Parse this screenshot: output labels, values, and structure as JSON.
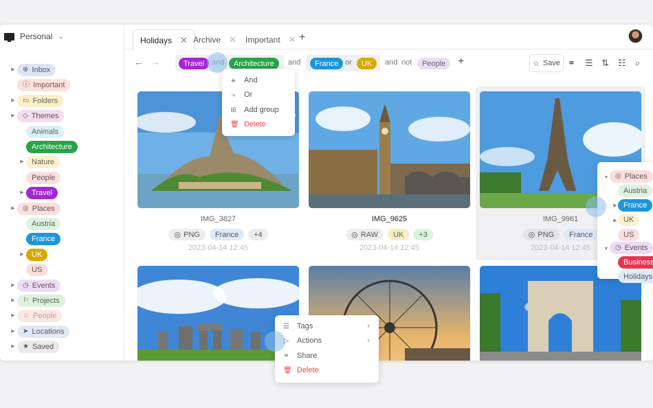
{
  "workspace": {
    "name": "Personal"
  },
  "tabs": [
    {
      "label": "Holidays",
      "active": true
    },
    {
      "label": "Archive",
      "active": false
    },
    {
      "label": "Important",
      "active": false
    }
  ],
  "sidebar": {
    "items": [
      {
        "label": "Inbox",
        "icon": "inbox-icon",
        "glyph": "⊕",
        "bg": "#dde5f3",
        "fg": "#556",
        "indent": 0,
        "arrow": true
      },
      {
        "label": "Important",
        "icon": "alert-icon",
        "glyph": "ⓘ",
        "bg": "#fbe0dd",
        "fg": "#755",
        "indent": 0,
        "arrow": false
      },
      {
        "label": "Folders",
        "icon": "folder-icon",
        "glyph": "▭",
        "bg": "#fbefc8",
        "fg": "#665",
        "indent": 0,
        "arrow": true
      },
      {
        "label": "Themes",
        "icon": "tag-icon",
        "glyph": "◇",
        "bg": "#f2dcef",
        "fg": "#655",
        "indent": 0,
        "arrow": true
      },
      {
        "label": "Animals",
        "bg": "#ddeff5",
        "fg": "#566",
        "indent": 1,
        "arrow": false
      },
      {
        "label": "Architecture",
        "bg": "#27a349",
        "fg": "#fff",
        "indent": 1,
        "arrow": false
      },
      {
        "label": "Nature",
        "bg": "#fbf0cf",
        "fg": "#665",
        "indent": 1,
        "arrow": true
      },
      {
        "label": "People",
        "bg": "#f9dede",
        "fg": "#655",
        "indent": 1,
        "arrow": false
      },
      {
        "label": "Travel",
        "bg": "#a526d6",
        "fg": "#fff",
        "indent": 1,
        "arrow": true
      },
      {
        "label": "Places",
        "icon": "pin-icon",
        "glyph": "◎",
        "bg": "#f9dede",
        "fg": "#655",
        "indent": 0,
        "arrow": true
      },
      {
        "label": "Austria",
        "bg": "#def2df",
        "fg": "#565",
        "indent": 1,
        "arrow": false
      },
      {
        "label": "France",
        "bg": "#1e95d8",
        "fg": "#fff",
        "indent": 1,
        "arrow": false
      },
      {
        "label": "UK",
        "bg": "#d9a800",
        "fg": "#fff",
        "indent": 1,
        "arrow": true
      },
      {
        "label": "US",
        "bg": "#f9dede",
        "fg": "#655",
        "indent": 1,
        "arrow": false
      },
      {
        "label": "Events",
        "icon": "clock-icon",
        "glyph": "◷",
        "bg": "#ecdcf4",
        "fg": "#655",
        "indent": 0,
        "arrow": true
      },
      {
        "label": "Projects",
        "icon": "flag-icon",
        "glyph": "⚐",
        "bg": "#ddf1dc",
        "fg": "#565",
        "indent": 0,
        "arrow": true
      },
      {
        "label": "People",
        "icon": "people-icon",
        "glyph": "☺",
        "bg": "#fbe7e4",
        "fg": "#b9a0a0",
        "indent": 0,
        "arrow": true
      },
      {
        "label": "Locations",
        "icon": "location-icon",
        "glyph": "➤",
        "bg": "#e2e8f5",
        "fg": "#556",
        "indent": 0,
        "arrow": true
      },
      {
        "label": "Saved",
        "icon": "star-icon",
        "glyph": "★",
        "bg": "#eaeaea",
        "fg": "#555",
        "indent": 0,
        "arrow": true
      }
    ]
  },
  "filter": {
    "travel": "Travel",
    "and1": "and",
    "architecture": "Architecture",
    "and2": "and",
    "france": "France",
    "or": "or",
    "uk": "UK",
    "and3": "and",
    "not": "not",
    "people": "People",
    "save_label": "Save",
    "colors": {
      "travel": "#a526d6",
      "architecture": "#27a349",
      "france": "#1e95d8",
      "uk": "#d9a800",
      "people": "#ecdcf4"
    }
  },
  "group_menu": {
    "items": [
      "And",
      "Or",
      "Add group",
      "Delete"
    ]
  },
  "context_menu": {
    "items": [
      "Tags",
      "Actions",
      "Share",
      "Delete"
    ]
  },
  "photos": [
    {
      "name": "IMG_3827",
      "bold": false,
      "tags": [
        "PNG",
        "France",
        "+4"
      ],
      "date": "2023-04-14 12:45",
      "scene": "mont-saint-michel"
    },
    {
      "name": "IMG_9625",
      "bold": true,
      "tags": [
        "RAW",
        "UK",
        "+3"
      ],
      "date": "2023-04-14 12:45",
      "scene": "big-ben"
    },
    {
      "name": "IMG_9961",
      "bold": false,
      "tags": [
        "PNG",
        "France"
      ],
      "date": "2023-04-14 12:45",
      "scene": "eiffel-tower"
    },
    {
      "scene": "stonehenge"
    },
    {
      "scene": "london-eye"
    },
    {
      "scene": "arc-de-triomphe"
    }
  ],
  "tag_panel": {
    "places": "Places",
    "austria": "Austria",
    "france": "France",
    "uk": "UK",
    "us": "US",
    "events": "Events",
    "business": "Business",
    "holidays": "Holidays"
  }
}
